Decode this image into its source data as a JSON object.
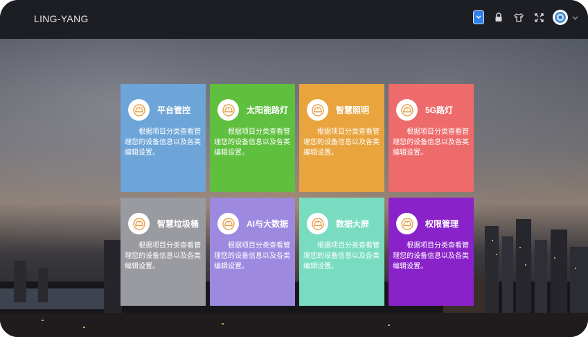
{
  "header": {
    "brand": "LING-YANG",
    "icons": [
      "screen-icon",
      "lock-icon",
      "shirt-icon",
      "fullscreen-icon",
      "avatar",
      "chevron-down-icon"
    ]
  },
  "tiles": [
    {
      "title": "平台管控",
      "desc": "根据项目分类查看管理您的设备信息以及各类编辑设置。",
      "color": "#6ea5d8"
    },
    {
      "title": "太阳能路灯",
      "desc": "根据项目分类查看管理您的设备信息以及各类编辑设置。",
      "color": "#5fbf3f"
    },
    {
      "title": "智慧照明",
      "desc": "根据项目分类查看管理您的设备信息以及各类编辑设置。",
      "color": "#e9a43e"
    },
    {
      "title": "5G路灯",
      "desc": "根据项目分类查看管理您的设备信息以及各类编辑设置。",
      "color": "#ee6b6b"
    },
    {
      "title": "智慧垃圾桶",
      "desc": "根据项目分类查看管理您的设备信息以及各类编辑设置。",
      "color": "#9a9ba0"
    },
    {
      "title": "AI与大数据",
      "desc": "根据项目分类查看管理您的设备信息以及各类编辑设置。",
      "color": "#9d8ae0"
    },
    {
      "title": "数据大屏",
      "desc": "根据项目分类查看管理您的设备信息以及各类编辑设置。",
      "color": "#79dcc0"
    },
    {
      "title": "权限管理",
      "desc": "根据项目分类查看管理您的设备信息以及各类编辑设置。",
      "color": "#8a22c9"
    }
  ]
}
